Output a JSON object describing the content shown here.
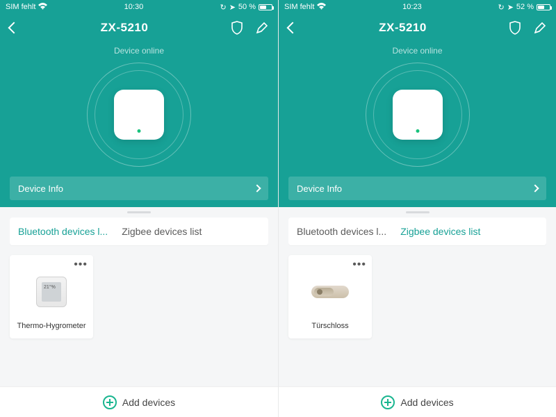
{
  "colors": {
    "accent": "#17a196",
    "accent2": "#19b58f"
  },
  "screens": [
    {
      "statusbar": {
        "carrier": "SIM fehlt",
        "time": "10:30",
        "battery_pct": "50 %",
        "battery_fill_css_width": "50%"
      },
      "header": {
        "title": "ZX-5210"
      },
      "hero": {
        "status": "Device online"
      },
      "device_info": {
        "label": "Device Info"
      },
      "tabs": [
        {
          "label": "Bluetooth devices l...",
          "active": true
        },
        {
          "label": "Zigbee devices list",
          "active": false
        }
      ],
      "card": {
        "name": "Thermo-Hygrometer",
        "kind": "thermo"
      },
      "add_label": "Add devices"
    },
    {
      "statusbar": {
        "carrier": "SIM fehlt",
        "time": "10:23",
        "battery_pct": "52 %",
        "battery_fill_css_width": "52%"
      },
      "header": {
        "title": "ZX-5210"
      },
      "hero": {
        "status": "Device online"
      },
      "device_info": {
        "label": "Device Info"
      },
      "tabs": [
        {
          "label": "Bluetooth devices l...",
          "active": false
        },
        {
          "label": "Zigbee devices list",
          "active": true
        }
      ],
      "card": {
        "name": "Türschloss",
        "kind": "lock"
      },
      "add_label": "Add devices"
    }
  ]
}
